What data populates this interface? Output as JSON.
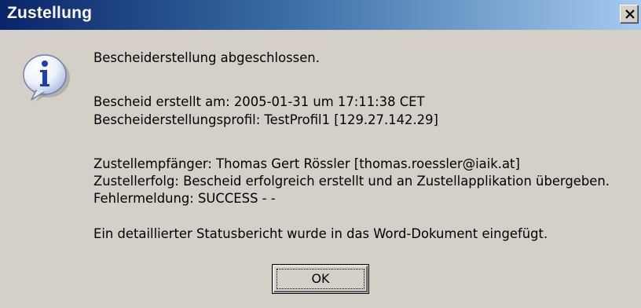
{
  "window": {
    "title": "Zustellung",
    "close_label": "x"
  },
  "icon": "info-icon",
  "message": {
    "line1": "Bescheiderstellung abgeschlossen.",
    "line2": "Bescheid erstellt am: 2005-01-31 um 17:11:38 CET",
    "line3": "Bescheiderstellungsprofil: TestProfil1  [129.27.142.29]",
    "line4": "Zustellempfänger: Thomas Gert Rössler [thomas.roessler@iaik.at]",
    "line5": "Zustellerfolg: Bescheid erfolgreich erstellt und an Zustellapplikation übergeben.",
    "line6": "Fehlermeldung: SUCCESS - -",
    "line7": "Ein detaillierter Statusbericht wurde in das Word-Dokument eingefügt."
  },
  "buttons": {
    "ok_label": "OK"
  },
  "colors": {
    "titlebar_start": "#0a246a",
    "titlebar_end": "#a6caf0",
    "face": "#d4d0c8"
  }
}
